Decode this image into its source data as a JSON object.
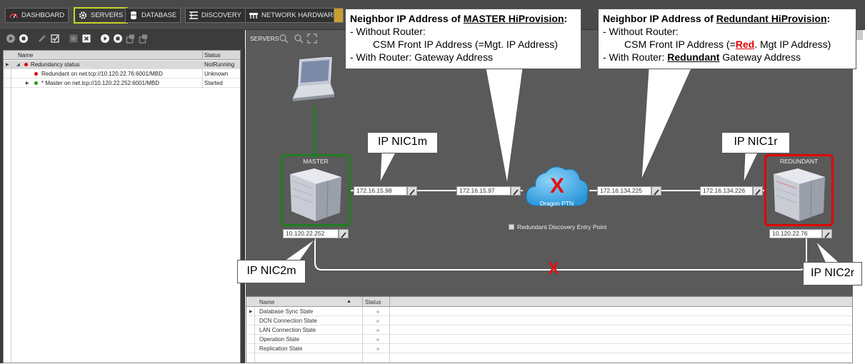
{
  "nav": {
    "dashboard": "DASHBOARD",
    "servers": "SERVERS",
    "database": "DATABASE",
    "discovery": "DISCOVERY",
    "network_hardware": "NETWORK HARDWARE"
  },
  "tree": {
    "col_name": "Name",
    "col_status": "Status",
    "rows": [
      {
        "name": "Redundancy status",
        "status": "NotRunning"
      },
      {
        "name": "Redundant on net.tcp://10.120.22.76:6001/MBD",
        "status": "Unknown"
      },
      {
        "name": "* Master on net.tcp://10.120.22.252:6001/MBD",
        "status": "Started"
      }
    ]
  },
  "topology": {
    "toolbar_label": "SERVERS",
    "master_label": "MASTER",
    "redundant_label": "REDUNDANT",
    "cloud_label": "Dragon PTN",
    "checkbox_label": "Redundant Discovery Entry Point",
    "ip_master_nic1": "172.16.15.98",
    "ip_cloud_left": "172.16.15.97",
    "ip_cloud_right": "172.16.134.225",
    "ip_redundant_nic1": "172.16.134.226",
    "ip_master_mgmt": "10.120.22.252",
    "ip_redundant_mgmt": "10.120.22.76"
  },
  "grid": {
    "col_name": "Name",
    "col_status": "Status",
    "rows": [
      "Database Sync State",
      "DCN Connection State",
      "LAN Connection State",
      "Operation State",
      "Replication State"
    ]
  },
  "callouts": {
    "master_title_prefix": "Neighbor IP Address of ",
    "master_title_emph": "MASTER HiProvision",
    "master_title_suffix": ":",
    "master_line1": "- Without Router:",
    "master_line2": "CSM Front IP Address (=Mgt. IP Address)",
    "master_line3": "- With Router: Gateway Address",
    "red_title_prefix": "Neighbor IP Address of ",
    "red_title_emph": "Redundant HiProvision",
    "red_title_suffix": ":",
    "red_line1": "- Without Router:",
    "red_line2_prefix": "CSM Front IP Address (=",
    "red_line2_emph": "Red",
    "red_line2_suffix": ". Mgt IP Address)",
    "red_line3_prefix": "- With Router: ",
    "red_line3_emph": "Redundant",
    "red_line3_suffix": " Gateway Address",
    "nic1m": "IP NIC1m",
    "nic1r": "IP NIC1r",
    "nic2m": "IP NIC2m",
    "nic2r": "IP NIC2r",
    "x_mark": "X"
  },
  "colors": {
    "master_border": "#1e7f1e",
    "redundant_border": "#e00000",
    "nav_active_border": "#c8d52b",
    "cloud": "#35a9ea",
    "x_mark": "#e41010"
  }
}
